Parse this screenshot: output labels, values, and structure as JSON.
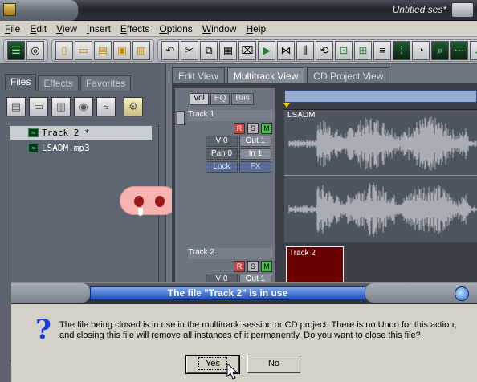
{
  "window": {
    "title": "Untitled.ses*"
  },
  "menu": [
    "File",
    "Edit",
    "View",
    "Insert",
    "Effects",
    "Options",
    "Window",
    "Help"
  ],
  "left_panel": {
    "tabs": [
      "Files",
      "Effects",
      "Favorites"
    ],
    "active_tab": "Files",
    "files": [
      {
        "name": "Track 2 *",
        "selected": true
      },
      {
        "name": "LSADM.mp3",
        "selected": false
      }
    ]
  },
  "main_tabs": [
    "Edit View",
    "Multitrack View",
    "CD Project View"
  ],
  "active_main_tab": "Multitrack View",
  "track_panel_tabs": [
    "Vol",
    "EQ",
    "Bus"
  ],
  "tracks": [
    {
      "name": "Track 1",
      "volume": "V 0",
      "pan": "Pan 0",
      "out": "Out 1",
      "in": "In 1",
      "lock": "Lock",
      "fx": "FX",
      "clip_label": "LSADM"
    },
    {
      "name": "Track 2",
      "volume": "V 0",
      "out": "Out 1",
      "clip_label": "Track 2"
    }
  ],
  "track_buttons": {
    "record": "R",
    "solo": "S",
    "mute": "M"
  },
  "dialog": {
    "title": "The file \"Track 2\" is in use",
    "message_line1": "The file being closed is in use in the multitrack session or CD project.  There is no Undo for this action,",
    "message_line2": "and closing this file will remove all instances of it permanently.  Do you want to close this file?",
    "yes_label": "Yes",
    "no_label": "No"
  },
  "icons": [
    "question-icon",
    "close-icon",
    "waveform-icon",
    "folder-icon",
    "save-icon",
    "cursor-icon"
  ],
  "colors": {
    "dialog_bar": "#1e50c0",
    "clip_track2": "#6a0000",
    "wave_green": "#4cf07a",
    "pig_pink": "#f7b3b0"
  }
}
